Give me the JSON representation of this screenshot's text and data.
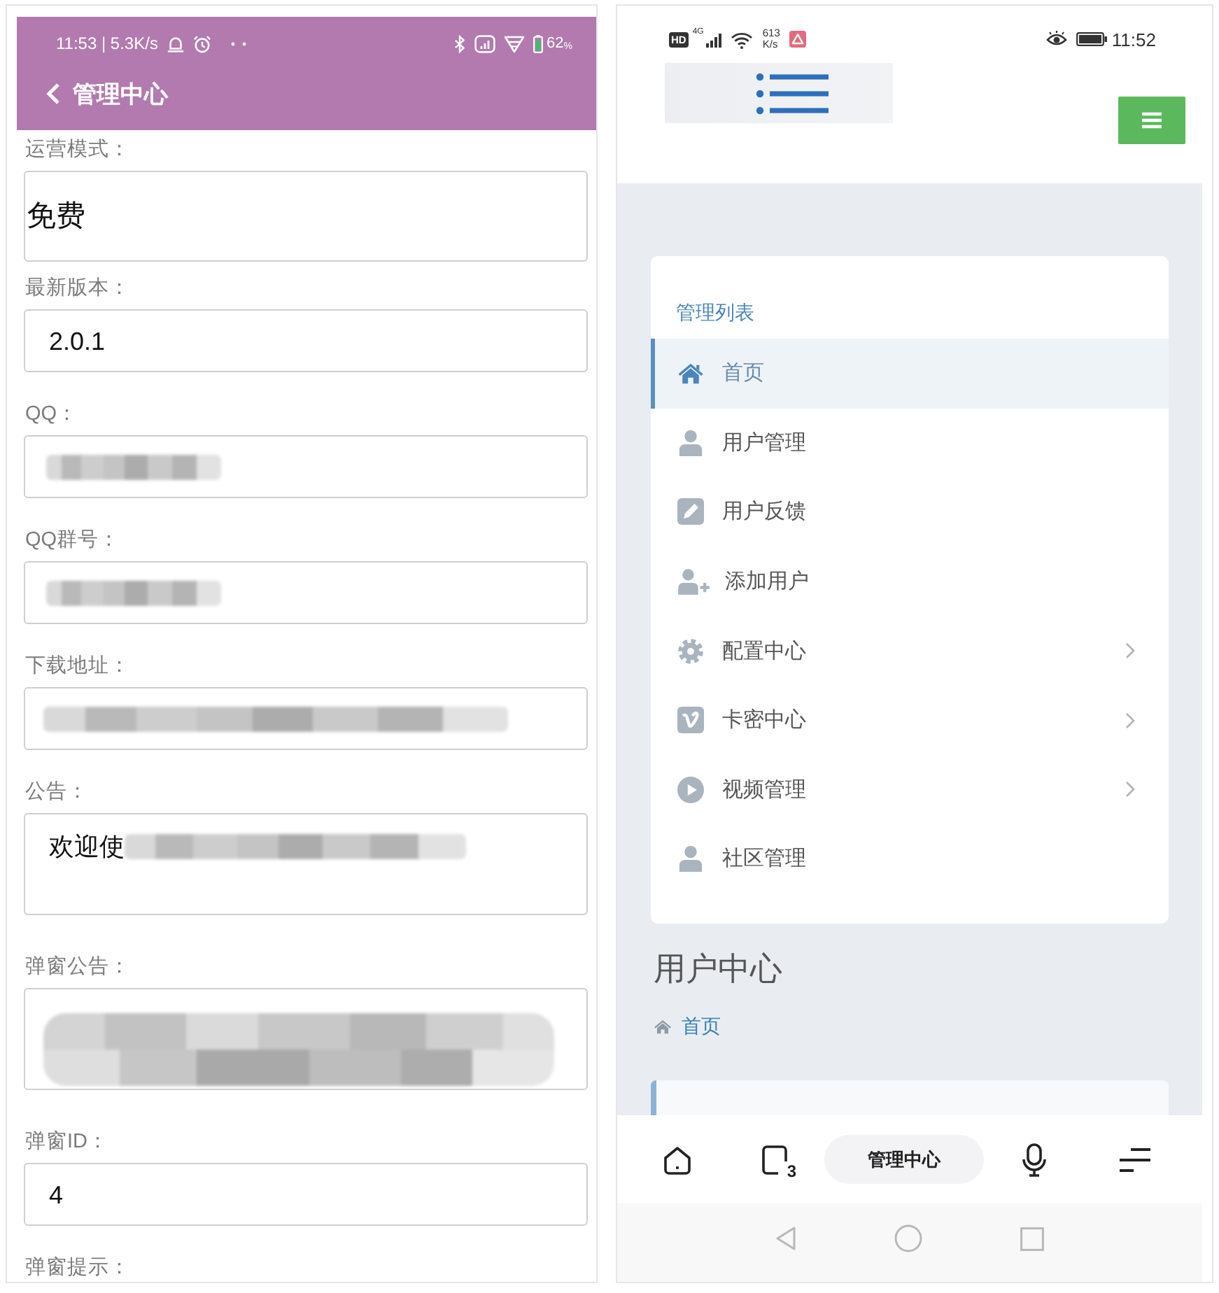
{
  "left_phone": {
    "status_bar": {
      "time_and_speed": "11:53 | 5.3K/s",
      "battery": "62$_{%}$"
    },
    "app_bar": {
      "title": "管理中心"
    },
    "fields": [
      {
        "label": "运营模式：",
        "kind": "select",
        "value": "免费"
      },
      {
        "label": "最新版本：",
        "kind": "input",
        "value": "2.0.1"
      },
      {
        "label": "QQ：",
        "kind": "input",
        "redaction": {
          "kind": "short"
        }
      },
      {
        "label": "QQ群号：",
        "kind": "input",
        "redaction": {
          "kind": "short"
        }
      },
      {
        "label": "下载地址：",
        "kind": "input",
        "redaction": {
          "kind": "long"
        }
      },
      {
        "label": "公告：",
        "kind": "textarea",
        "value": "欢迎使",
        "redaction": {
          "kind": "inline"
        }
      },
      {
        "label": "弹窗公告：",
        "kind": "textarea",
        "redaction": {
          "kind": "block"
        }
      },
      {
        "label": "弹窗ID：",
        "kind": "input",
        "value": "4"
      },
      {
        "label": "弹窗提示：",
        "kind": "label"
      }
    ]
  },
  "right_phone": {
    "status_bar": {
      "hd": "HD",
      "network": "4G",
      "speed": "613",
      "speed_unit": "K/s",
      "time": "11:52"
    },
    "sidebar": {
      "heading": "管理列表",
      "items": [
        {
          "label": "首页",
          "kind": "home",
          "selected": true,
          "expandable": false
        },
        {
          "label": "用户管理",
          "kind": "user",
          "selected": false,
          "expandable": false
        },
        {
          "label": "用户反馈",
          "kind": "edit",
          "selected": false,
          "expandable": false
        },
        {
          "label": "添加用户",
          "kind": "adduser",
          "selected": false,
          "expandable": false
        },
        {
          "label": "配置中心",
          "kind": "settings",
          "selected": false,
          "expandable": true
        },
        {
          "label": "卡密中心",
          "kind": "card",
          "selected": false,
          "expandable": true
        },
        {
          "label": "视频管理",
          "kind": "video",
          "selected": false,
          "expandable": true
        },
        {
          "label": "社区管理",
          "kind": "user",
          "selected": false,
          "expandable": false
        }
      ]
    },
    "content": {
      "title": "用户中心",
      "breadcrumb": "首页"
    },
    "browser_bar": {
      "tab_count": "3",
      "address": "管理中心"
    }
  }
}
